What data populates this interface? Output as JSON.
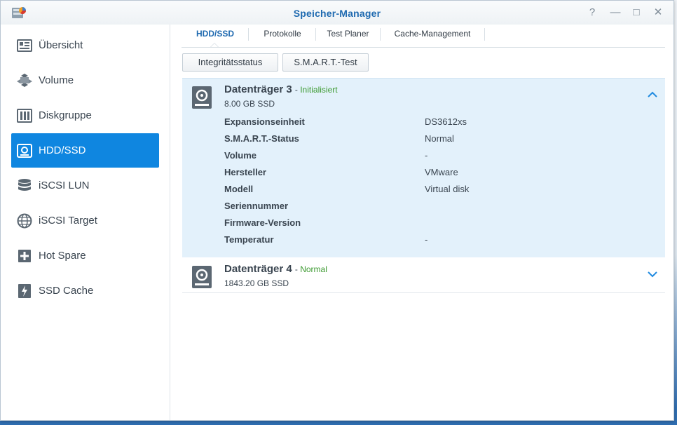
{
  "window": {
    "title": "Speicher-Manager"
  },
  "controls": {
    "help": "?",
    "minimize": "—",
    "maximize": "□",
    "close": "✕"
  },
  "sidebar": {
    "items": [
      {
        "label": "Übersicht",
        "icon": "overview-icon",
        "active": false
      },
      {
        "label": "Volume",
        "icon": "volume-cubes-icon",
        "active": false
      },
      {
        "label": "Diskgruppe",
        "icon": "diskgroup-icon",
        "active": false
      },
      {
        "label": "HDD/SSD",
        "icon": "hdd-icon",
        "active": true
      },
      {
        "label": "iSCSI LUN",
        "icon": "database-icon",
        "active": false
      },
      {
        "label": "iSCSI Target",
        "icon": "globe-icon",
        "active": false
      },
      {
        "label": "Hot Spare",
        "icon": "hot-spare-icon",
        "active": false
      },
      {
        "label": "SSD Cache",
        "icon": "ssd-cache-icon",
        "active": false
      }
    ]
  },
  "tabs": [
    {
      "label": "HDD/SSD",
      "active": true
    },
    {
      "label": "Protokolle",
      "active": false
    },
    {
      "label": "Test Planer",
      "active": false
    },
    {
      "label": "Cache-Management",
      "active": false
    }
  ],
  "toolbar": {
    "integrity_label": "Integritätsstatus",
    "smart_label": "S.M.A.R.T.-Test"
  },
  "disks": [
    {
      "name": "Datenträger 3",
      "status": "Initialisiert",
      "size": "8.00 GB SSD",
      "expanded": true,
      "properties": [
        {
          "key": "Expansionseinheit",
          "value": "DS3612xs"
        },
        {
          "key": "S.M.A.R.T.-Status",
          "value": "Normal"
        },
        {
          "key": "Volume",
          "value": "-"
        },
        {
          "key": "Hersteller",
          "value": "VMware"
        },
        {
          "key": "Modell",
          "value": "Virtual disk"
        },
        {
          "key": "Seriennummer",
          "value": ""
        },
        {
          "key": "Firmware-Version",
          "value": ""
        },
        {
          "key": "Temperatur",
          "value": "-"
        }
      ]
    },
    {
      "name": "Datenträger 4",
      "status": "Normal",
      "size": "1843.20 GB SSD",
      "expanded": false
    }
  ],
  "colors": {
    "accent": "#0f86e0",
    "title": "#1f6ab0",
    "status_ok": "#3c9a30",
    "expanded_bg": "#e3f1fb"
  }
}
